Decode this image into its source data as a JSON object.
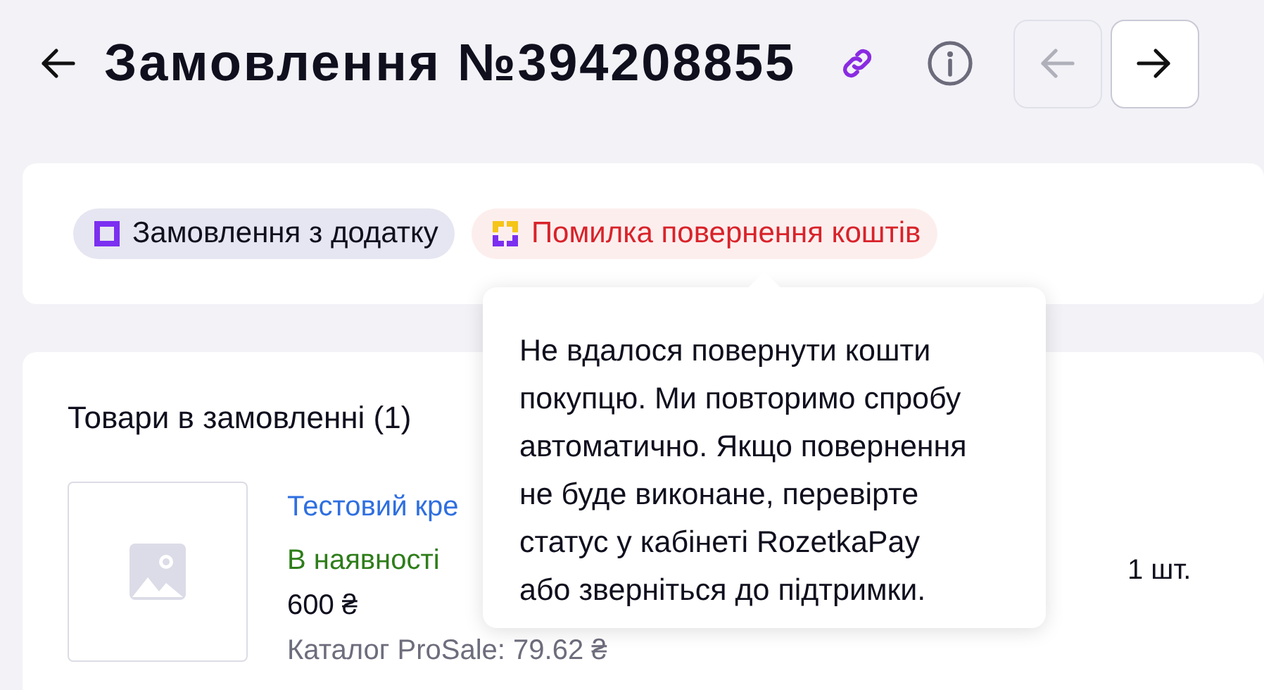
{
  "header": {
    "title": "Замовлення №394208855",
    "nav": [
      {
        "kind": "prev",
        "disabled": true
      },
      {
        "kind": "next",
        "disabled": false
      }
    ]
  },
  "badges": [
    {
      "kind": "info",
      "label": "Замовлення з додатку"
    },
    {
      "kind": "error",
      "label": "Помилка повернення коштів"
    }
  ],
  "tooltip": {
    "text": "Не вдалося повернути кошти покупцю. Ми повторимо спробу автоматично. Якщо повернення не буде виконане, перевірте статус у кабінеті RozetkaPay або зверніться до підтримки."
  },
  "products": {
    "title": "Товари в замовленні (1)",
    "items": [
      {
        "name": "Тестовий кре",
        "availability": "В наявності",
        "price": "600 ₴",
        "catalog": "Каталог ProSale: 79.62 ₴",
        "quantity": "1 шт."
      }
    ]
  }
}
